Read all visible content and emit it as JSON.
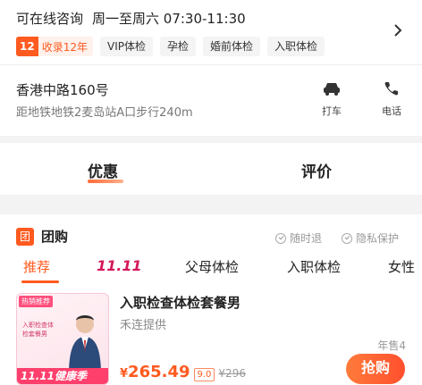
{
  "info": {
    "consult": "可在线咨询",
    "hours": "周一至周六 07:30-11:30",
    "years_num": "12",
    "years_text": "收录12年",
    "tags": [
      "VIP体检",
      "孕检",
      "婚前体检",
      "入职体检"
    ],
    "address": "香港中路160号",
    "distance": "距地铁地铁2麦岛站A口步行240m",
    "actions": {
      "taxi_label": "打车",
      "phone_label": "电话"
    }
  },
  "tabs": {
    "youhui": "优惠",
    "pingjia": "评价"
  },
  "group": {
    "badge": "团",
    "title": "团购",
    "guarantees": [
      "随时退",
      "隐私保护"
    ],
    "subtabs": [
      "推荐",
      "11.11",
      "父母体检",
      "入职体检",
      "女性"
    ]
  },
  "deal": {
    "title": "入职检查体检套餐男",
    "provider": "禾连提供",
    "sales": "年售4",
    "price_symbol": "¥",
    "price": "265.49",
    "discount": "9.0",
    "original": "¥296",
    "buy_label": "抢购",
    "image": {
      "badge": "热销推荐",
      "text": "入职检查体检套餐男",
      "banner": "11.11健康季"
    }
  },
  "colors": {
    "accent": "#ff5a1f",
    "festival": "#d4185b"
  }
}
